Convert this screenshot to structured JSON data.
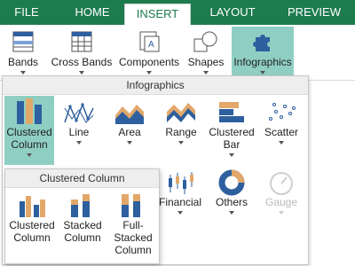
{
  "tabs": [
    "FILE",
    "HOME",
    "INSERT",
    "LAYOUT",
    "PREVIEW"
  ],
  "ribbon": {
    "bands": "Bands",
    "cross_bands": "Cross Bands",
    "components": "Components",
    "shapes": "Shapes",
    "infographics": "Infographics"
  },
  "gallery": {
    "title": "Infographics",
    "items": [
      "Clustered Column",
      "Line",
      "Area",
      "Range",
      "Clustered Bar",
      "Scatter",
      "Financial",
      "Others",
      "Gauge"
    ]
  },
  "submenu": {
    "title": "Clustered Column",
    "items": [
      "Clustered Column",
      "Stacked Column",
      "Full-Stacked Column"
    ]
  },
  "colors": {
    "accent": "#1e7b4e",
    "selected": "#8fcfc3",
    "series_blue": "#2e5f9e",
    "series_orange": "#e2a86a"
  }
}
